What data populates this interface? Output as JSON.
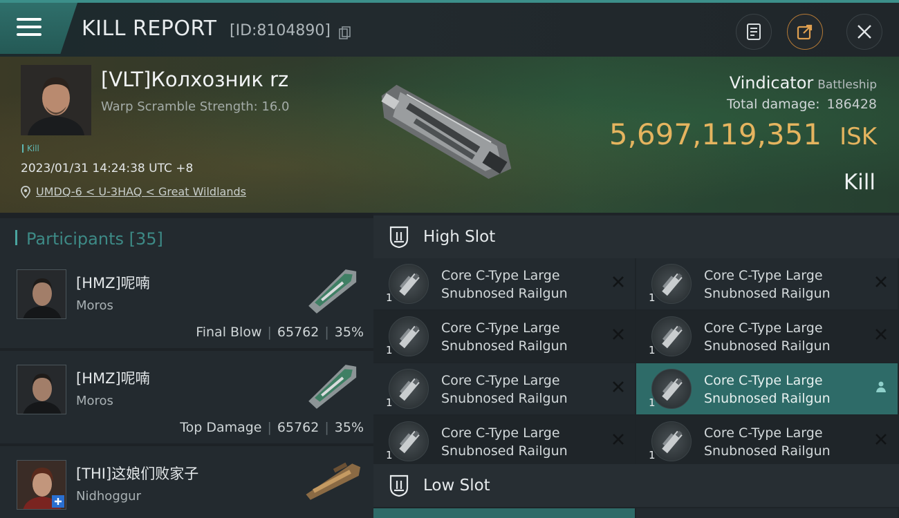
{
  "header": {
    "title": "KILL REPORT",
    "report_id": "[ID:8104890]",
    "icons": [
      "menu-icon",
      "copy-icon",
      "document-icon",
      "share-icon",
      "close-icon"
    ]
  },
  "victim": {
    "name": "[VLT]Колхозник rz",
    "warp_scramble": "Warp Scramble Strength: 16.0",
    "tag": "Kill",
    "datetime": "2023/01/31 14:24:38 UTC +8",
    "location": "UMDQ-6 < U-3HAQ < Great Wildlands",
    "ship_name": "Vindicator",
    "ship_class": "Battleship",
    "total_damage_label": "Total damage:",
    "total_damage": "186428",
    "isk_value": "5,697,119,351",
    "isk_unit": "ISK",
    "result": "Kill"
  },
  "participants": {
    "header": "Participants [35]",
    "rows": [
      {
        "name": "[HMZ]呢喃",
        "ship": "Moros",
        "role": "Final Blow",
        "damage": "65762",
        "percent": "35%"
      },
      {
        "name": "[HMZ]呢喃",
        "ship": "Moros",
        "role": "Top Damage",
        "damage": "65762",
        "percent": "35%"
      },
      {
        "name": "[THI]这娘们败家子",
        "ship": "Nidhoggur",
        "role": "",
        "damage": "",
        "percent": ""
      }
    ]
  },
  "high_slot": {
    "label": "High Slot",
    "modules": [
      {
        "qty": "1",
        "line1": "Core C-Type Large",
        "line2": "Snubnosed Railgun"
      },
      {
        "qty": "1",
        "line1": "Core C-Type Large",
        "line2": "Snubnosed Railgun"
      },
      {
        "qty": "1",
        "line1": "Core C-Type Large",
        "line2": "Snubnosed Railgun"
      },
      {
        "qty": "1",
        "line1": "Core C-Type Large",
        "line2": "Snubnosed Railgun"
      },
      {
        "qty": "1",
        "line1": "Core C-Type Large",
        "line2": "Snubnosed Railgun"
      },
      {
        "qty": "1",
        "line1": "Core C-Type Large",
        "line2": "Snubnosed Railgun"
      },
      {
        "qty": "1",
        "line1": "Core C-Type Large",
        "line2": "Snubnosed Railgun"
      },
      {
        "qty": "1",
        "line1": "Core C-Type Large",
        "line2": "Snubnosed Railgun"
      }
    ]
  },
  "low_slot": {
    "label": "Low Slot"
  },
  "colors": {
    "accent_teal": "#2e6b68",
    "isk_gold": "#e5b45f",
    "share_orange": "#b57a36"
  }
}
